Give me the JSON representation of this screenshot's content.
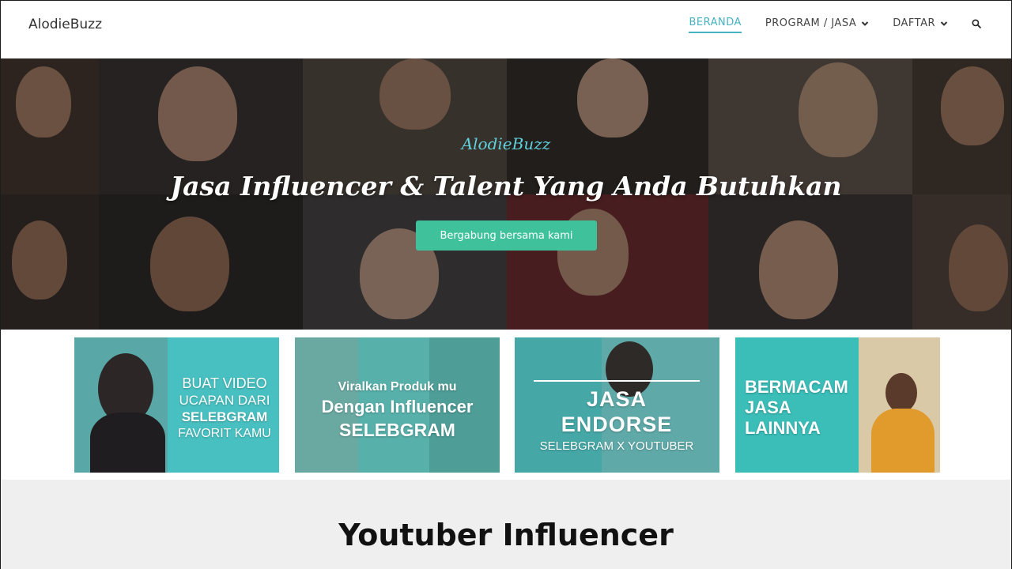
{
  "header": {
    "brand": "AlodieBuzz",
    "nav": [
      {
        "label": "BERANDA",
        "active": true
      },
      {
        "label": "PROGRAM / JASA",
        "dropdown": true
      },
      {
        "label": "DAFTAR",
        "dropdown": true
      }
    ],
    "search_icon": "search-icon"
  },
  "hero": {
    "brand": "AlodieBuzz",
    "title": "Jasa Influencer & Talent Yang Anda Butuhkan",
    "cta_label": "Bergabung bersama kami"
  },
  "banners": [
    {
      "lines": [
        "BUAT VIDEO",
        "UCAPAN DARI",
        "SELEBGRAM",
        "FAVORIT KAMU"
      ]
    },
    {
      "lines": [
        "Viralkan Produk mu",
        "Dengan Influencer",
        "SELEBGRAM"
      ]
    },
    {
      "lines": [
        "JASA ENDORSE",
        "SELEBGRAM X YOUTUBER"
      ]
    },
    {
      "lines": [
        "BERMACAM",
        "JASA",
        "LAINNYA"
      ]
    }
  ],
  "section": {
    "title": "Youtuber Influencer"
  },
  "colors": {
    "accent": "#46b3c0",
    "cta": "#3fc29b",
    "hero_brand": "#5fd0dc",
    "section_bg": "#efefef"
  }
}
